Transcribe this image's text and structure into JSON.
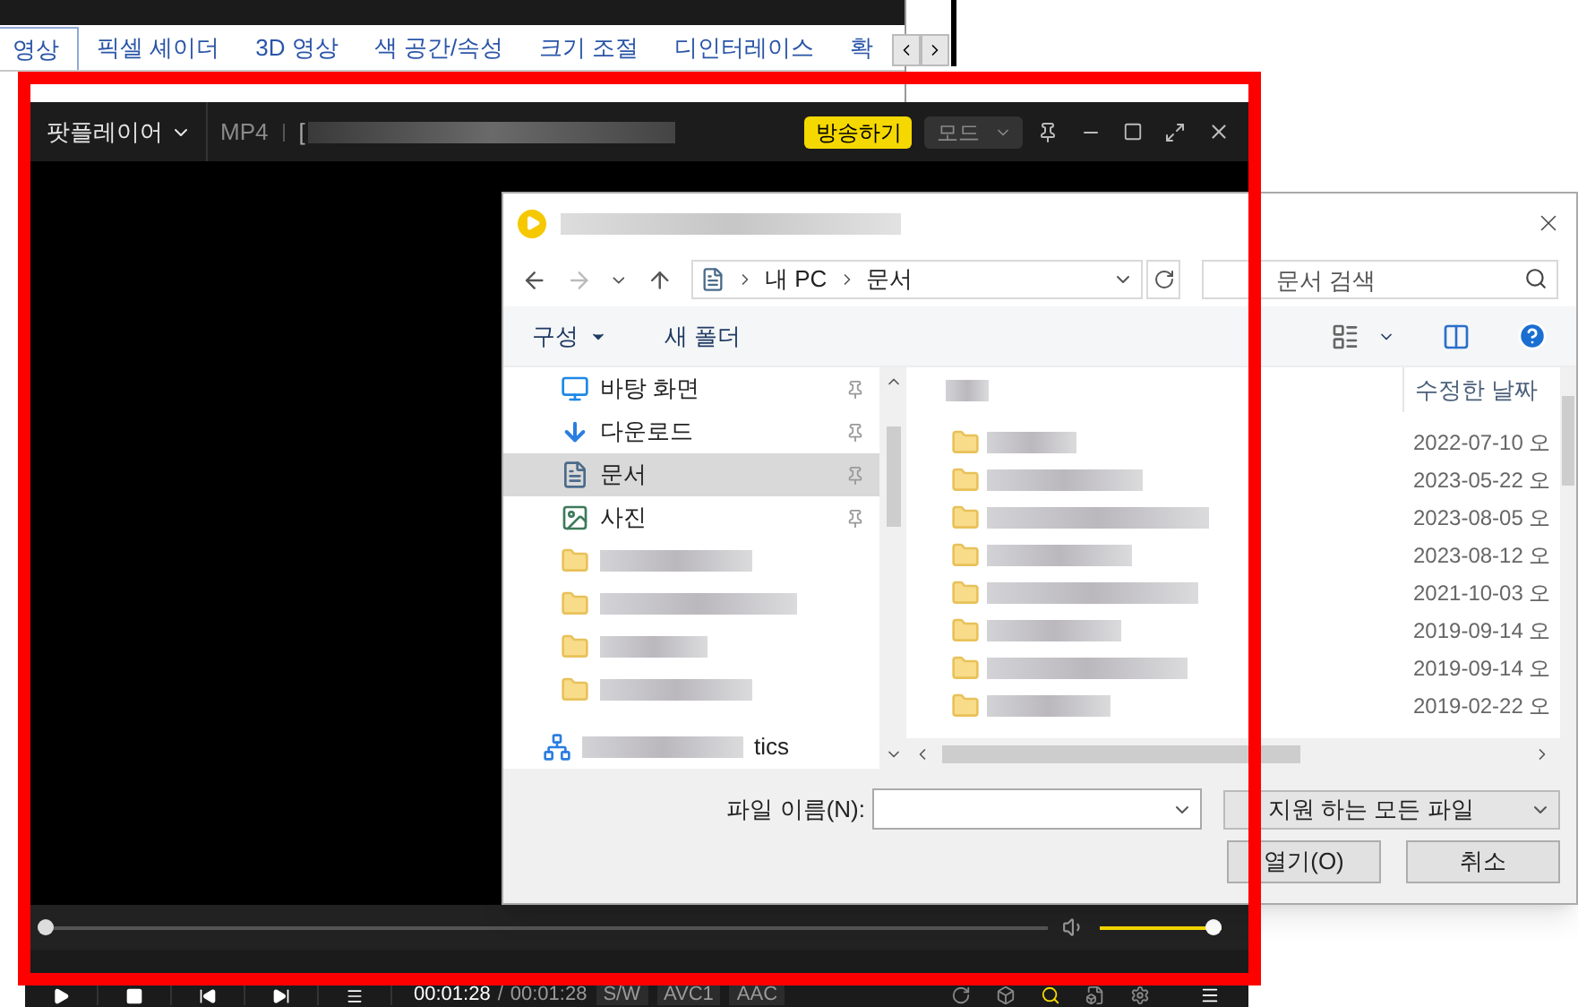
{
  "settings_window": {
    "tabs": [
      {
        "label": "영상",
        "selected": true
      },
      {
        "label": "픽셀 셰이더",
        "selected": false
      },
      {
        "label": "3D 영상",
        "selected": false
      },
      {
        "label": "색 공간/속성",
        "selected": false
      },
      {
        "label": "크기 조절",
        "selected": false
      },
      {
        "label": "디인터레이스",
        "selected": false
      },
      {
        "label": "확",
        "selected": false
      }
    ]
  },
  "player": {
    "menu_label": "팟플레이어",
    "format": "MP4",
    "title_prefix": "[",
    "broadcast_button": "방송하기",
    "mode_button": "모드",
    "seek": {
      "level": 0
    },
    "volume": {
      "level": 1
    },
    "time_current": "00:01:28",
    "time_separator": "/",
    "time_total": "00:01:28",
    "badges": [
      "S/W",
      "AVC1",
      "AAC"
    ]
  },
  "file_dialog": {
    "path": [
      "내 PC",
      "문서"
    ],
    "search_placeholder": "문서 검색",
    "organize_button": "구성",
    "new_folder_button": "새 폴더",
    "nav_items": [
      {
        "kind": "desktop",
        "label": "바탕 화면",
        "pinned": true,
        "selected": false
      },
      {
        "kind": "download",
        "label": "다운로드",
        "pinned": true,
        "selected": false
      },
      {
        "kind": "document",
        "label": "문서",
        "pinned": true,
        "selected": true
      },
      {
        "kind": "picture",
        "label": "사진",
        "pinned": true,
        "selected": false
      },
      {
        "kind": "folder",
        "pinned": false,
        "selected": false
      },
      {
        "kind": "folder",
        "pinned": false,
        "selected": false
      },
      {
        "kind": "folder",
        "pinned": false,
        "selected": false
      },
      {
        "kind": "folder",
        "pinned": false,
        "selected": false
      },
      {
        "kind": "network",
        "label": "tics",
        "pinned": false,
        "selected": false
      }
    ],
    "date_column": "수정한 날짜",
    "files": [
      {
        "date": "2022-07-10 오"
      },
      {
        "date": "2023-05-22 오"
      },
      {
        "date": "2023-08-05 오"
      },
      {
        "date": "2023-08-12 오"
      },
      {
        "date": "2021-10-03 오"
      },
      {
        "date": "2019-09-14 오"
      },
      {
        "date": "2019-09-14 오"
      },
      {
        "date": "2019-02-22 오"
      }
    ],
    "filename_label": "파일 이름(N):",
    "file_type": "지원 하는 모든 파일",
    "buttons": [
      "열기(O)",
      "취소"
    ]
  }
}
